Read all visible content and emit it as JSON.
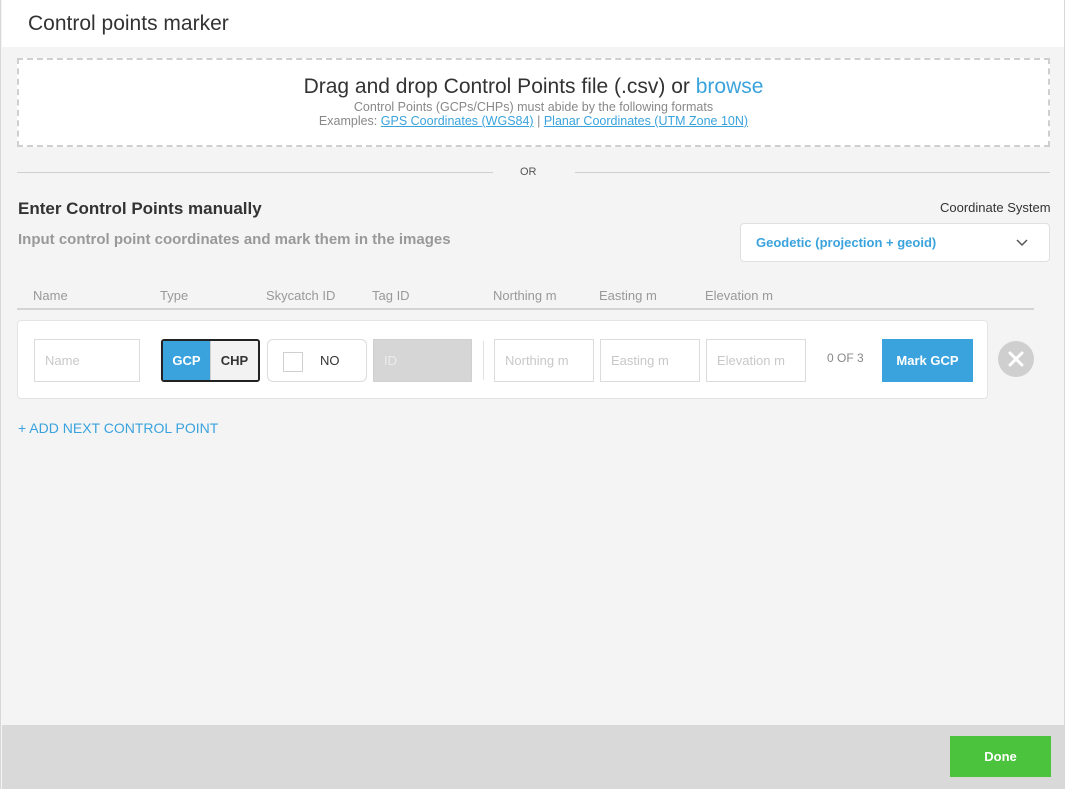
{
  "window": {
    "title": "Control points marker"
  },
  "upload": {
    "drag_text": "Drag and drop Control Points file (.csv) or",
    "browse_label": "browse",
    "format_note": "Control Points (GCPs/CHPs) must abide by the following formats",
    "examples_label": "Examples:",
    "example_gps": "GPS Coordinates (WGS84)",
    "separator": "|",
    "example_planar": "Planar Coordinates (UTM Zone 10N)"
  },
  "or_text": "OR",
  "manual": {
    "title": "Enter Control Points manually",
    "subtitle": "Input control point coordinates and mark them in the images"
  },
  "coordinate_system": {
    "label": "Coordinate System",
    "selected": "Geodetic (projection + geoid)",
    "icon": "chevron-down-icon"
  },
  "table": {
    "headers": {
      "name": "Name",
      "type": "Type",
      "skycatch_id": "Skycatch ID",
      "tag_id": "Tag ID",
      "northing": "Northing m",
      "easting": "Easting m",
      "elevation": "Elevation m"
    },
    "rows": [
      {
        "name_placeholder": "Name",
        "type_options": [
          "GCP",
          "CHP"
        ],
        "type_selected": "GCP",
        "skycatch_label": "NO",
        "skycatch_checked": false,
        "tag_placeholder": "ID",
        "northing_placeholder": "Northing m",
        "easting_placeholder": "Easting m",
        "elevation_placeholder": "Elevation m",
        "count": "0 OF 3",
        "mark_label": "Mark GCP"
      }
    ]
  },
  "add_next_label": "+ ADD NEXT CONTROL POINT",
  "footer": {
    "done_label": "Done"
  },
  "colors": {
    "accent": "#3aa3dd",
    "success": "#4bc33d"
  }
}
